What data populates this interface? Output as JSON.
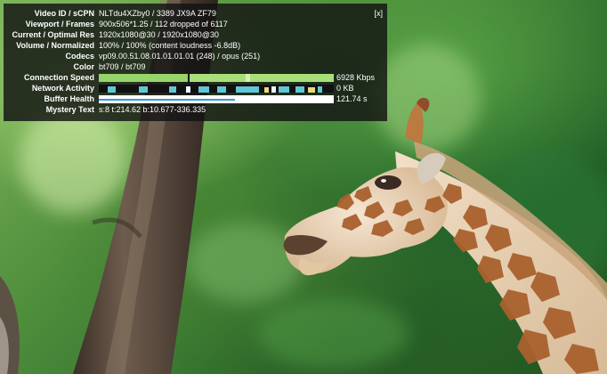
{
  "video": {
    "description": "Giraffe close-up in front of a tree trunk with blurred green foliage"
  },
  "stats": {
    "close_label": "[x]",
    "rows": [
      {
        "label": "Video ID / sCPN",
        "value": "NLTdu4XZby0 / 3389 JX9A ZF79"
      },
      {
        "label": "Viewport / Frames",
        "value": "900x506*1.25 / 112 dropped of 6117"
      },
      {
        "label": "Current / Optimal Res",
        "value": "1920x1080@30 / 1920x1080@30"
      },
      {
        "label": "Volume / Normalized",
        "value": "100% / 100% (content loudness -6.8dB)"
      },
      {
        "label": "Codecs",
        "value": "vp09.00.51.08.01.01.01.01 (248) / opus (251)"
      },
      {
        "label": "Color",
        "value": "bt709 / bt709"
      }
    ],
    "connection_speed": {
      "label": "Connection Speed",
      "value": "6928 Kbps"
    },
    "network_activity": {
      "label": "Network Activity",
      "value": "0 KB"
    },
    "buffer_health": {
      "label": "Buffer Health",
      "value": "121.74 s",
      "fill_fraction": 1.0,
      "line_fraction": 0.58
    },
    "mystery_text": {
      "label": "Mystery Text",
      "value": "s:8 t:214.62 b:10.677-336.335"
    },
    "colors": {
      "panel_bg": "#121212",
      "speed_green": "#95d56b",
      "network_cyan": "#61c6d8",
      "network_yellow": "#e7db77",
      "buffer_blue": "#2c9fd8"
    }
  }
}
